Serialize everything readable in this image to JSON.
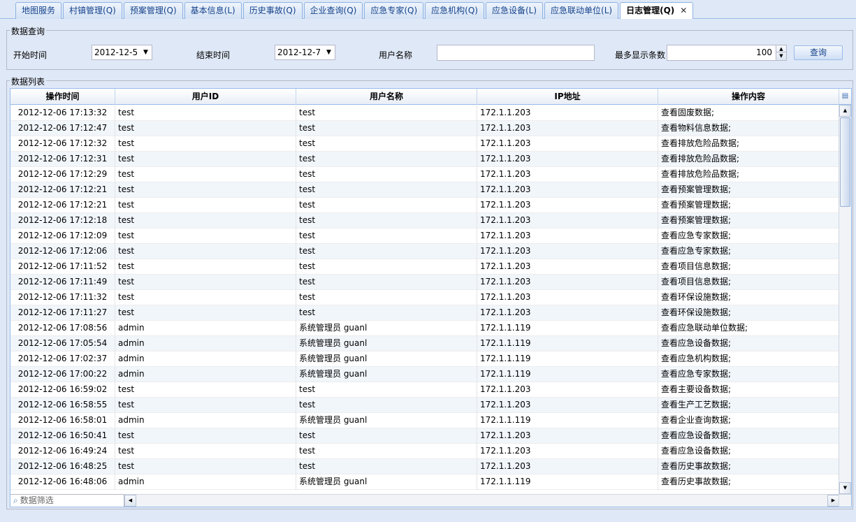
{
  "tabs": [
    {
      "label": "地图服务",
      "active": false
    },
    {
      "label": "村镇管理(Q)",
      "active": false
    },
    {
      "label": "预案管理(Q)",
      "active": false
    },
    {
      "label": "基本信息(L)",
      "active": false
    },
    {
      "label": "历史事故(Q)",
      "active": false
    },
    {
      "label": "企业查询(Q)",
      "active": false
    },
    {
      "label": "应急专家(Q)",
      "active": false
    },
    {
      "label": "应急机构(Q)",
      "active": false
    },
    {
      "label": "应急设备(L)",
      "active": false
    },
    {
      "label": "应急联动单位(L)",
      "active": false
    },
    {
      "label": "日志管理(Q)",
      "active": true
    }
  ],
  "tab_close_glyph": "✕",
  "query": {
    "legend": "数据查询",
    "start_label": "开始时间",
    "start_value": "2012-12-5",
    "end_label": "结束时间",
    "end_value": "2012-12-7",
    "user_label": "用户名称",
    "user_value": "",
    "max_label": "最多显示条数",
    "max_value": "100",
    "submit_label": "查询"
  },
  "list": {
    "legend": "数据列表",
    "columns": [
      "操作时间",
      "用户ID",
      "用户名称",
      "IP地址",
      "操作内容"
    ],
    "rows": [
      [
        "2012-12-06 17:13:32",
        "test",
        "test",
        "172.1.1.203",
        "查看固废数据;"
      ],
      [
        "2012-12-06 17:12:47",
        "test",
        "test",
        "172.1.1.203",
        "查看物料信息数据;"
      ],
      [
        "2012-12-06 17:12:32",
        "test",
        "test",
        "172.1.1.203",
        "查看排放危险品数据;"
      ],
      [
        "2012-12-06 17:12:31",
        "test",
        "test",
        "172.1.1.203",
        "查看排放危险品数据;"
      ],
      [
        "2012-12-06 17:12:29",
        "test",
        "test",
        "172.1.1.203",
        "查看排放危险品数据;"
      ],
      [
        "2012-12-06 17:12:21",
        "test",
        "test",
        "172.1.1.203",
        "查看预案管理数据;"
      ],
      [
        "2012-12-06 17:12:21",
        "test",
        "test",
        "172.1.1.203",
        "查看预案管理数据;"
      ],
      [
        "2012-12-06 17:12:18",
        "test",
        "test",
        "172.1.1.203",
        "查看预案管理数据;"
      ],
      [
        "2012-12-06 17:12:09",
        "test",
        "test",
        "172.1.1.203",
        "查看应急专家数据;"
      ],
      [
        "2012-12-06 17:12:06",
        "test",
        "test",
        "172.1.1.203",
        "查看应急专家数据;"
      ],
      [
        "2012-12-06 17:11:52",
        "test",
        "test",
        "172.1.1.203",
        "查看项目信息数据;"
      ],
      [
        "2012-12-06 17:11:49",
        "test",
        "test",
        "172.1.1.203",
        "查看项目信息数据;"
      ],
      [
        "2012-12-06 17:11:32",
        "test",
        "test",
        "172.1.1.203",
        "查看环保设施数据;"
      ],
      [
        "2012-12-06 17:11:27",
        "test",
        "test",
        "172.1.1.203",
        "查看环保设施数据;"
      ],
      [
        "2012-12-06 17:08:56",
        "admin",
        "系统管理员 guanl",
        "172.1.1.119",
        "查看应急联动单位数据;"
      ],
      [
        "2012-12-06 17:05:54",
        "admin",
        "系统管理员 guanl",
        "172.1.1.119",
        "查看应急设备数据;"
      ],
      [
        "2012-12-06 17:02:37",
        "admin",
        "系统管理员 guanl",
        "172.1.1.119",
        "查看应急机构数据;"
      ],
      [
        "2012-12-06 17:00:22",
        "admin",
        "系统管理员 guanl",
        "172.1.1.119",
        "查看应急专家数据;"
      ],
      [
        "2012-12-06 16:59:02",
        "test",
        "test",
        "172.1.1.203",
        "查看主要设备数据;"
      ],
      [
        "2012-12-06 16:58:55",
        "test",
        "test",
        "172.1.1.203",
        "查看生产工艺数据;"
      ],
      [
        "2012-12-06 16:58:01",
        "admin",
        "系统管理员 guanl",
        "172.1.1.119",
        "查看企业查询数据;"
      ],
      [
        "2012-12-06 16:50:41",
        "test",
        "test",
        "172.1.1.203",
        "查看应急设备数据;"
      ],
      [
        "2012-12-06 16:49:24",
        "test",
        "test",
        "172.1.1.203",
        "查看应急设备数据;"
      ],
      [
        "2012-12-06 16:48:25",
        "test",
        "test",
        "172.1.1.203",
        "查看历史事故数据;"
      ],
      [
        "2012-12-06 16:48:06",
        "admin",
        "系统管理员 guanl",
        "172.1.1.119",
        "查看历史事故数据;"
      ]
    ],
    "filter_placeholder": "数据筛选"
  },
  "icons": {
    "dropdown": "chevron-down-icon",
    "spinner_up": "triangle-up-icon",
    "spinner_down": "triangle-down-icon",
    "search": "magnifier-icon",
    "column_menu": "column-menu-icon"
  },
  "colors": {
    "tab_text": "#15428b",
    "border": "#99bbe8",
    "background": "#dfe8f6",
    "row_alt": "#f1f6fb"
  }
}
